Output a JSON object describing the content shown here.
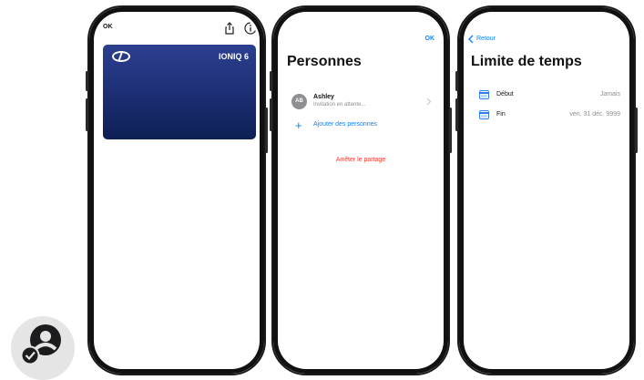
{
  "phone1": {
    "ok_label": "OK",
    "card_title": "IONIQ 6",
    "share_icon": "share-icon",
    "info_icon": "info-icon",
    "logo_icon": "hyundai-logo"
  },
  "phone2": {
    "ok_label": "OK",
    "title": "Personnes",
    "person": {
      "initials": "AB",
      "name": "Ashley",
      "status": "Invitation en attente..."
    },
    "add_people": "Ajouter des personnes",
    "stop_sharing": "Arrêter le partage"
  },
  "phone3": {
    "back_label": "Retour",
    "title": "Limite de temps",
    "rows": [
      {
        "label": "Début",
        "value": "Jamais"
      },
      {
        "label": "Fin",
        "value": "ven. 31 déc. 9999"
      }
    ]
  },
  "colors": {
    "accent": "#0a84ff",
    "destructive": "#ff3b30",
    "card": "#1f3178"
  }
}
